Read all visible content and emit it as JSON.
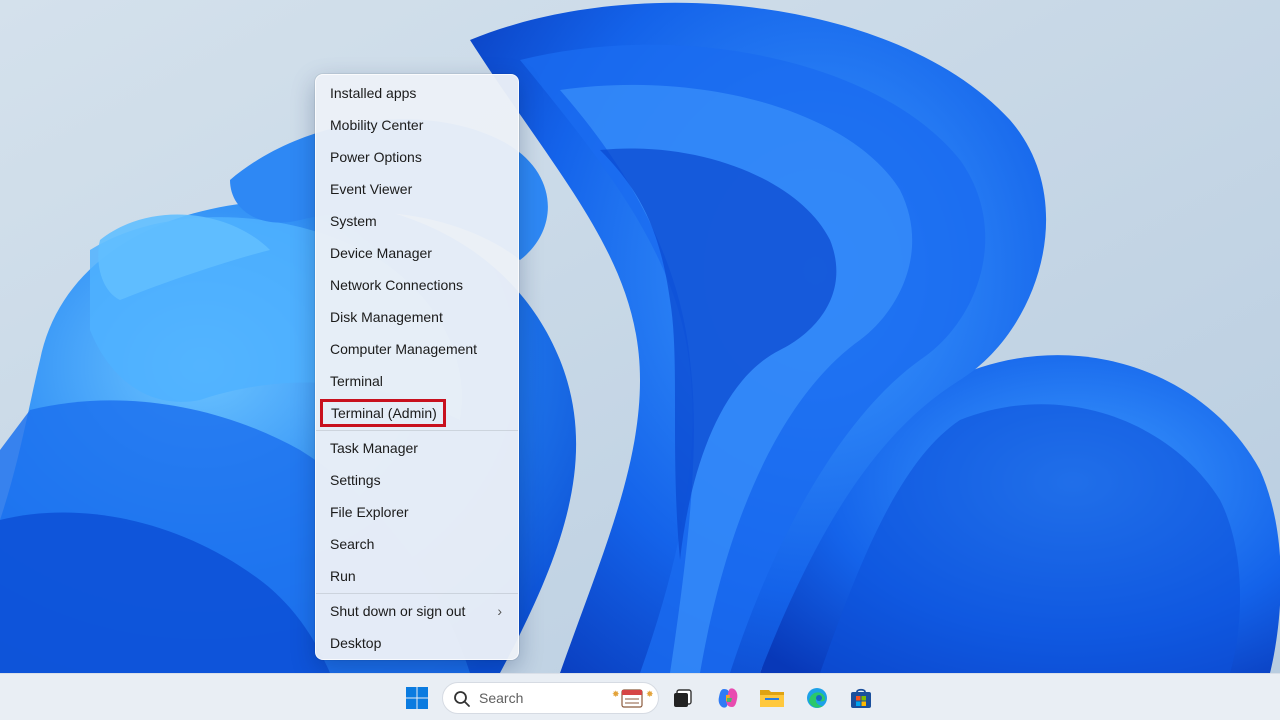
{
  "menu": {
    "items_top": [
      {
        "label": "Installed apps"
      },
      {
        "label": "Mobility Center"
      },
      {
        "label": "Power Options"
      },
      {
        "label": "Event Viewer"
      },
      {
        "label": "System"
      },
      {
        "label": "Device Manager"
      },
      {
        "label": "Network Connections"
      },
      {
        "label": "Disk Management"
      },
      {
        "label": "Computer Management"
      },
      {
        "label": "Terminal"
      },
      {
        "label": "Terminal (Admin)"
      }
    ],
    "items_mid": [
      {
        "label": "Task Manager"
      },
      {
        "label": "Settings"
      },
      {
        "label": "File Explorer"
      },
      {
        "label": "Search"
      },
      {
        "label": "Run"
      }
    ],
    "items_bottom": [
      {
        "label": "Shut down or sign out",
        "chevron": "›"
      },
      {
        "label": "Desktop"
      }
    ],
    "highlight_color": "#c8101e"
  },
  "taskbar": {
    "search_placeholder": "Search",
    "icons": [
      "start-icon",
      "search-icon",
      "task-view-icon",
      "copilot-icon",
      "file-explorer-icon",
      "edge-icon",
      "store-icon"
    ],
    "accent": "#0078d4"
  },
  "wallpaper": {
    "primary": "#1565e8",
    "light": "#4fb1ff",
    "background": "#c9d8e6"
  }
}
